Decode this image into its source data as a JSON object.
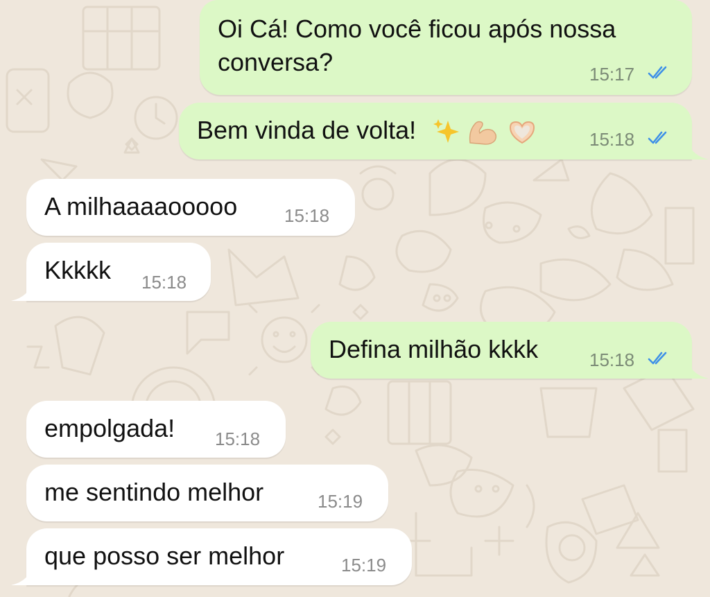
{
  "colors": {
    "background": "#efe7dc",
    "outgoing_bubble": "#dcf8c6",
    "incoming_bubble": "#ffffff",
    "read_ticks": "#3d8fe8",
    "timestamp": "#7b8a76"
  },
  "messages": [
    {
      "direction": "outgoing",
      "text": "Oi Cá! Como você ficou após nossa conversa?",
      "time": "15:17",
      "status": "read"
    },
    {
      "direction": "outgoing",
      "text": "Bem vinda de volta!",
      "emojis": [
        "sparkles-emoji",
        "flexed-biceps-emoji",
        "heart-hands-emoji"
      ],
      "time": "15:18",
      "status": "read"
    },
    {
      "direction": "incoming",
      "text": "A milhaaaaooooo",
      "time": "15:18"
    },
    {
      "direction": "incoming",
      "text": "Kkkkk",
      "time": "15:18"
    },
    {
      "direction": "outgoing",
      "text": "Defina milhão kkkk",
      "time": "15:18",
      "status": "read"
    },
    {
      "direction": "incoming",
      "text": "empolgada!",
      "time": "15:18"
    },
    {
      "direction": "incoming",
      "text": "me sentindo melhor",
      "time": "15:19"
    },
    {
      "direction": "incoming",
      "text": "que posso ser melhor",
      "time": "15:19"
    }
  ]
}
